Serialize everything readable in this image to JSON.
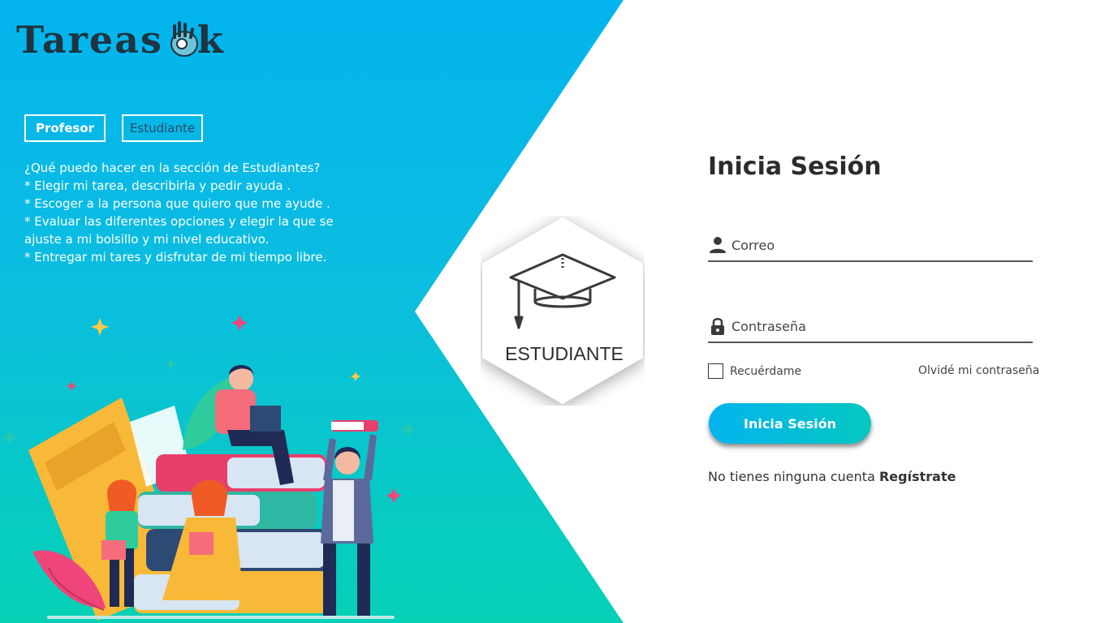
{
  "brand": {
    "name": "Tareas",
    "suffix": "k"
  },
  "role_tabs": [
    {
      "label": "Profesor"
    },
    {
      "label": "Estudiante"
    }
  ],
  "info": {
    "lines": [
      "¿Qué puedo hacer en la sección de Estudiantes?",
      "* Elegir mi tarea, describirla y pedir ayuda .",
      "* Escoger a la persona que quiero que me ayude .",
      "* Evaluar las diferentes opciones y elegir la que se ajuste a mi bolsillo y mi nivel educativo.",
      "* Entregar mi tares y disfrutar de mi tiempo libre."
    ]
  },
  "badge": {
    "label": "ESTUDIANTE",
    "icon": "graduation-cap-icon"
  },
  "login": {
    "title": "Inicia Sesión",
    "email_placeholder": "Correo",
    "password_placeholder": "Contraseña",
    "remember_label": "Recuérdame",
    "forgot_label": "Olvidé mi contraseña",
    "submit_label": "Inicia Sesión",
    "register_prompt": "No tienes ninguna cuenta",
    "register_link": "Regístrate"
  },
  "colors": {
    "accent_start": "#03b4ee",
    "accent_end": "#06d1b6",
    "text_dark": "#2c2c2c"
  }
}
